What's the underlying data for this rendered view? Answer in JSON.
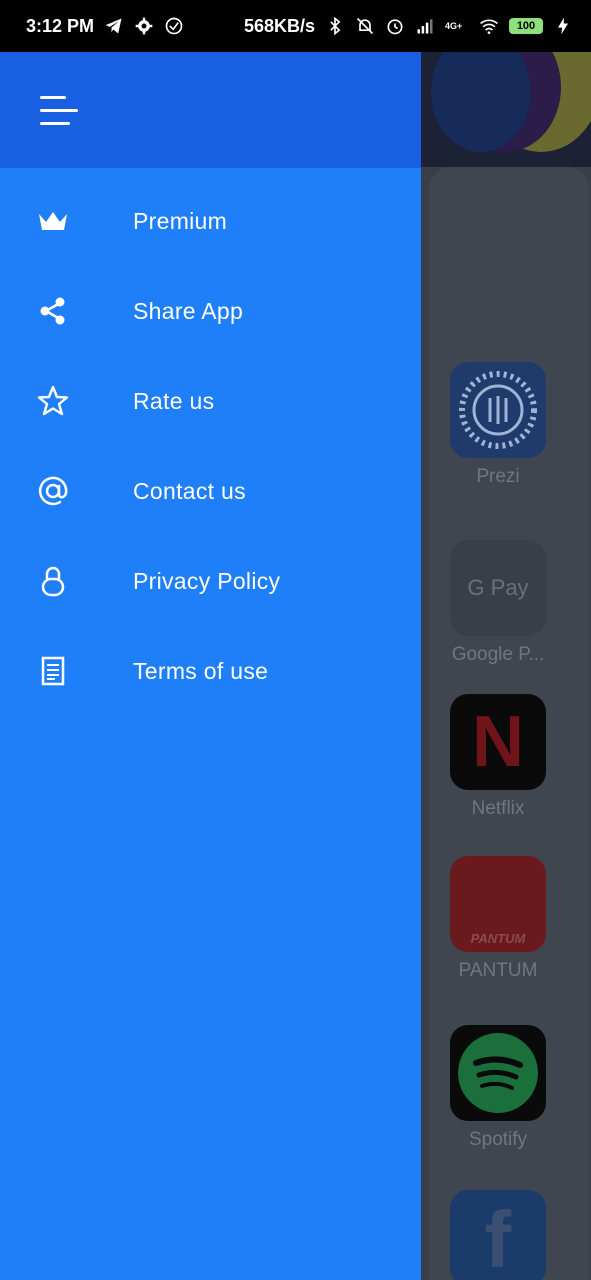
{
  "status_bar": {
    "time": "3:12 PM",
    "speed": "568KB/s",
    "network": "4G+",
    "battery": "100"
  },
  "drawer": {
    "items": [
      {
        "label": "Premium",
        "icon": "crown-icon"
      },
      {
        "label": "Share App",
        "icon": "share-icon"
      },
      {
        "label": "Rate us",
        "icon": "star-icon"
      },
      {
        "label": "Contact us",
        "icon": "at-icon"
      },
      {
        "label": "Privacy Policy",
        "icon": "lock-icon"
      },
      {
        "label": "Terms of use",
        "icon": "document-icon"
      }
    ]
  },
  "background_apps": [
    {
      "label": "Prezi"
    },
    {
      "label": "Google P...",
      "icon_text": "G Pay"
    },
    {
      "label": "Netflix",
      "icon_text": "N"
    },
    {
      "label": "PANTUM",
      "icon_text": "PANTUM"
    },
    {
      "label": "Spotify"
    },
    {
      "label": "",
      "icon_text": "f"
    }
  ],
  "colors": {
    "drawer_bg": "#1f7ff8",
    "drawer_header": "#185fe1",
    "status_bar": "#000000"
  }
}
